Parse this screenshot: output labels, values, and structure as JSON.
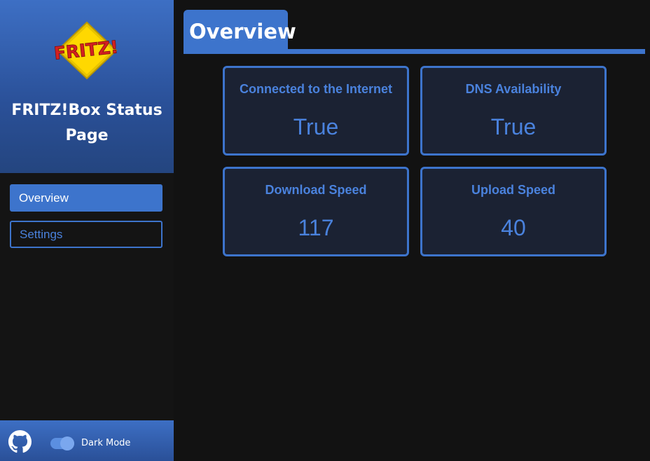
{
  "sidebar": {
    "logo_text": "FRITZ!",
    "title": "FRITZ!Box Status Page",
    "nav": [
      {
        "label": "Overview",
        "active": true
      },
      {
        "label": "Settings",
        "active": false
      }
    ],
    "footer": {
      "github_icon": "github-icon",
      "dark_mode_label": "Dark Mode",
      "dark_mode_on": true
    }
  },
  "main": {
    "tab_title": "Overview",
    "cards": [
      {
        "title": "Connected to the Internet",
        "value": "True"
      },
      {
        "title": "DNS Availability",
        "value": "True"
      },
      {
        "title": "Download Speed",
        "value": "117"
      },
      {
        "title": "Upload Speed",
        "value": "40"
      }
    ]
  },
  "colors": {
    "accent": "#3d74cc",
    "accent_text": "#4a82dd",
    "background": "#121212",
    "card_background": "#1b2233"
  }
}
